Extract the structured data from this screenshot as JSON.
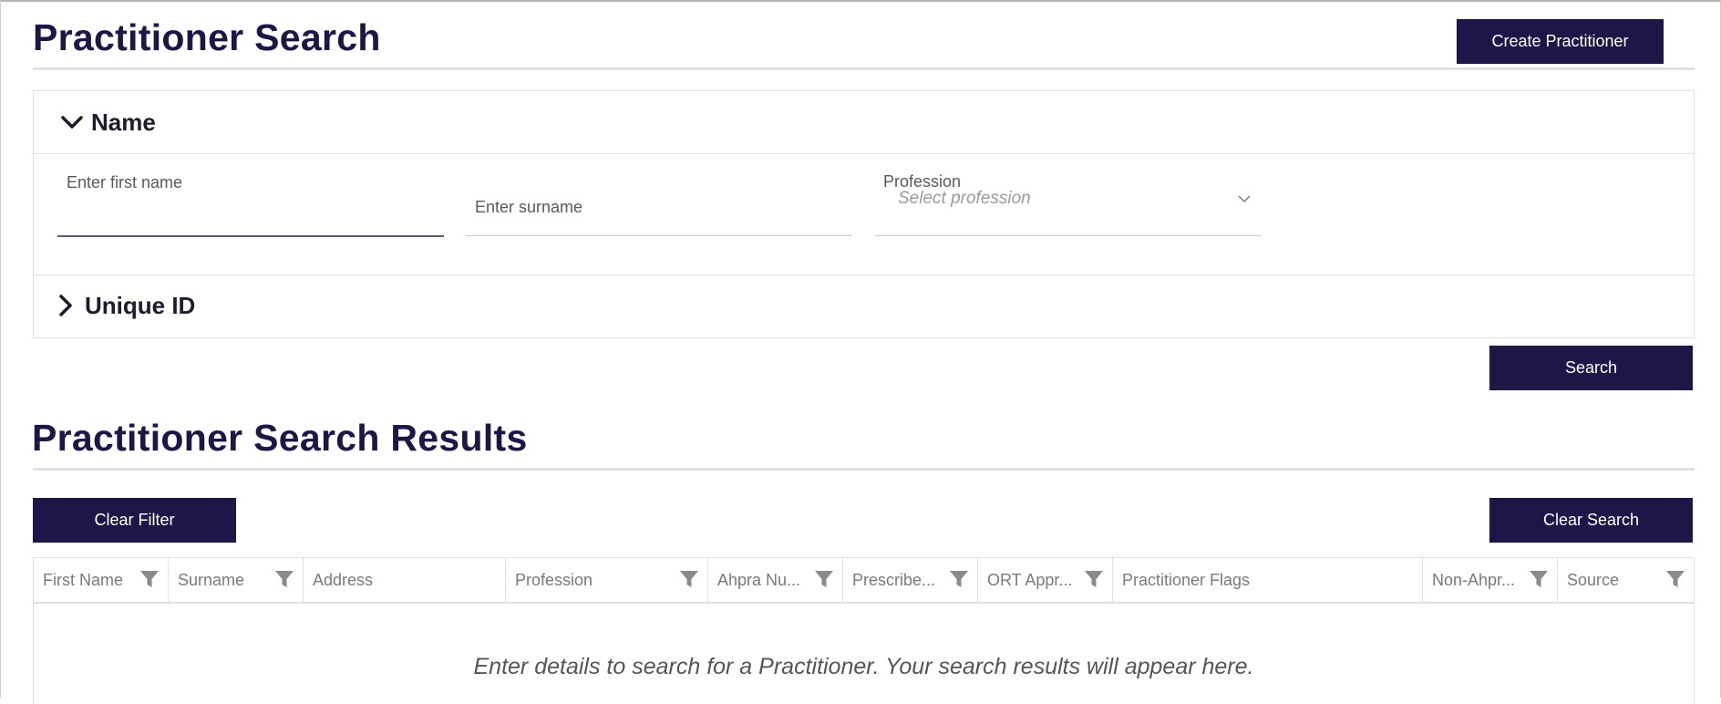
{
  "page": {
    "title": "Practitioner Search",
    "create_button": "Create Practitioner"
  },
  "search": {
    "name_section": "Name",
    "first_name_label": "Enter first name",
    "surname_label": "Enter surname",
    "profession_label": "Profession",
    "profession_placeholder": "Select profession",
    "unique_id_section": "Unique ID",
    "search_button": "Search"
  },
  "results": {
    "title": "Practitioner Search Results",
    "clear_filter_button": "Clear Filter",
    "clear_search_button": "Clear Search",
    "columns": [
      {
        "label": "First Name",
        "filter": true
      },
      {
        "label": "Surname",
        "filter": true
      },
      {
        "label": "Address",
        "filter": false
      },
      {
        "label": "Profession",
        "filter": true
      },
      {
        "label": "Ahpra Nu...",
        "filter": true
      },
      {
        "label": "Prescribe...",
        "filter": true
      },
      {
        "label": "ORT Appr...",
        "filter": true
      },
      {
        "label": "Practitioner Flags",
        "filter": false
      },
      {
        "label": "Non-Ahpr...",
        "filter": true
      },
      {
        "label": "Source",
        "filter": true
      }
    ],
    "empty_message": "Enter details to search for a Practitioner. Your search results will appear here."
  },
  "colors": {
    "brand": "#201547",
    "border": "#e0e0e0",
    "filter_icon": "#8a8a8a"
  },
  "icons": {
    "expanded": "chevron-down-icon",
    "collapsed": "chevron-right-icon",
    "select": "chevron-down-icon",
    "column_filter": "filter-icon"
  }
}
